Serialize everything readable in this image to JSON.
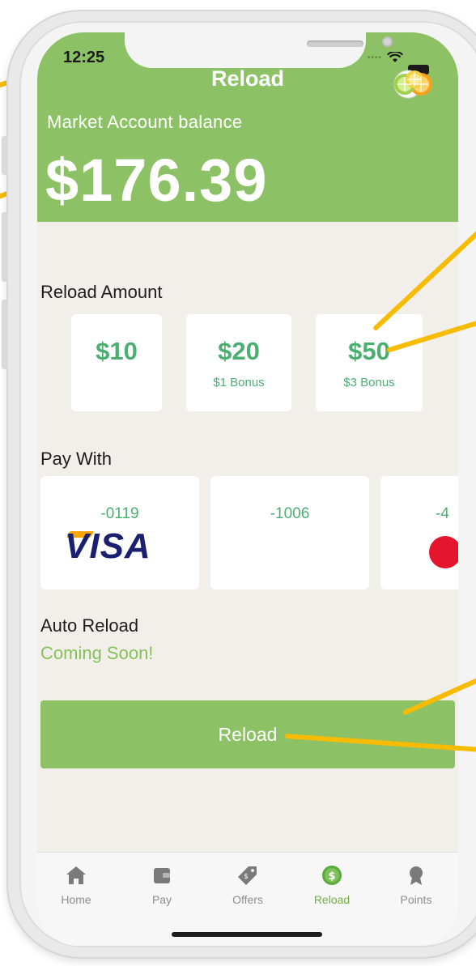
{
  "status_bar": {
    "time": "12:25"
  },
  "header": {
    "title": "Reload",
    "balance_label": "Market Account balance",
    "balance_value": "$176.39"
  },
  "reload_amount": {
    "label": "Reload Amount",
    "options": [
      {
        "value": "$10",
        "bonus": ""
      },
      {
        "value": "$20",
        "bonus": "$1 Bonus"
      },
      {
        "value": "$50",
        "bonus": "$3 Bonus"
      }
    ]
  },
  "pay_with": {
    "label": "Pay With",
    "cards": [
      {
        "number": "-0119",
        "brand": "VISA"
      },
      {
        "number": "-1006",
        "brand": ""
      },
      {
        "number": "-4",
        "brand": "Mastercard"
      }
    ]
  },
  "auto_reload": {
    "label": "Auto Reload",
    "status": "Coming Soon!"
  },
  "reload_button": {
    "label": "Reload"
  },
  "tabs": [
    {
      "label": "Home",
      "icon": "home-icon",
      "active": false
    },
    {
      "label": "Pay",
      "icon": "wallet-icon",
      "active": false
    },
    {
      "label": "Offers",
      "icon": "tag-icon",
      "active": false
    },
    {
      "label": "Reload",
      "icon": "dollar-coin-icon",
      "active": true
    },
    {
      "label": "Points",
      "icon": "award-icon",
      "active": false
    }
  ],
  "colors": {
    "brand_green": "#8cc265",
    "value_green": "#4caf72",
    "callout_yellow": "#f7bb00",
    "background": "#f2efea"
  }
}
